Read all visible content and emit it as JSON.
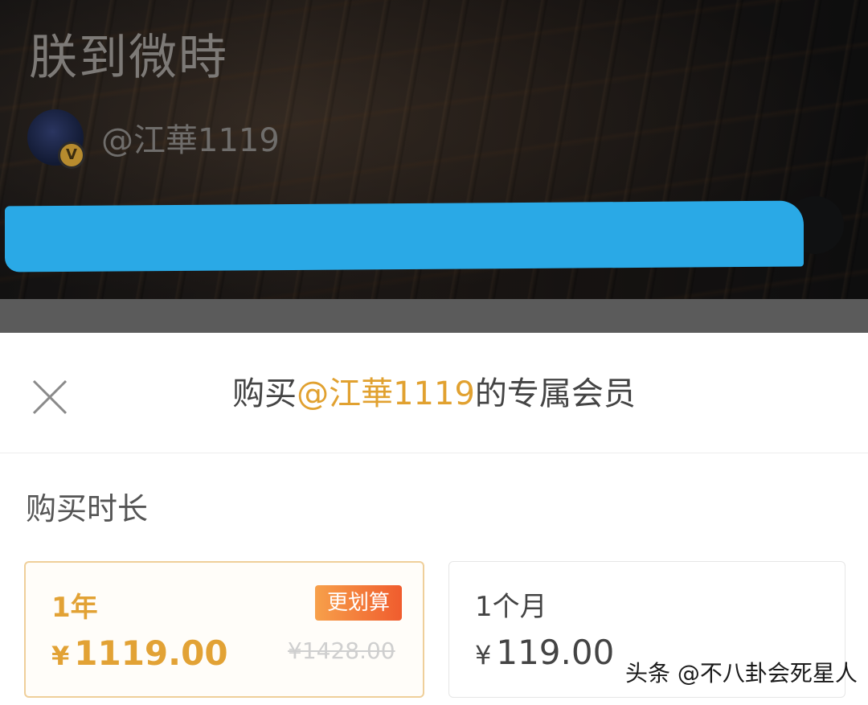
{
  "banner": {
    "title": "朕到微時",
    "author_handle": "@江華1119",
    "verified_badge": "V"
  },
  "sheet": {
    "title_prefix": "购买",
    "title_highlight": "@江華1119",
    "title_suffix": "的专属会员",
    "close_icon": "close-icon",
    "duration_label": "购买时长",
    "plans": [
      {
        "name": "1年",
        "currency": "¥",
        "price": "1119.00",
        "badge": "更划算",
        "original_price": "¥1428.00",
        "selected": true
      },
      {
        "name": "1个月",
        "currency": "¥",
        "price": "119.00",
        "selected": false
      }
    ]
  },
  "watermark": "头条 @不八卦会死星人",
  "colors": {
    "accent": "#e2a235",
    "badge_gradient_start": "#f7a04a",
    "badge_gradient_end": "#f05c2e",
    "redaction": "#2aa9e6"
  }
}
